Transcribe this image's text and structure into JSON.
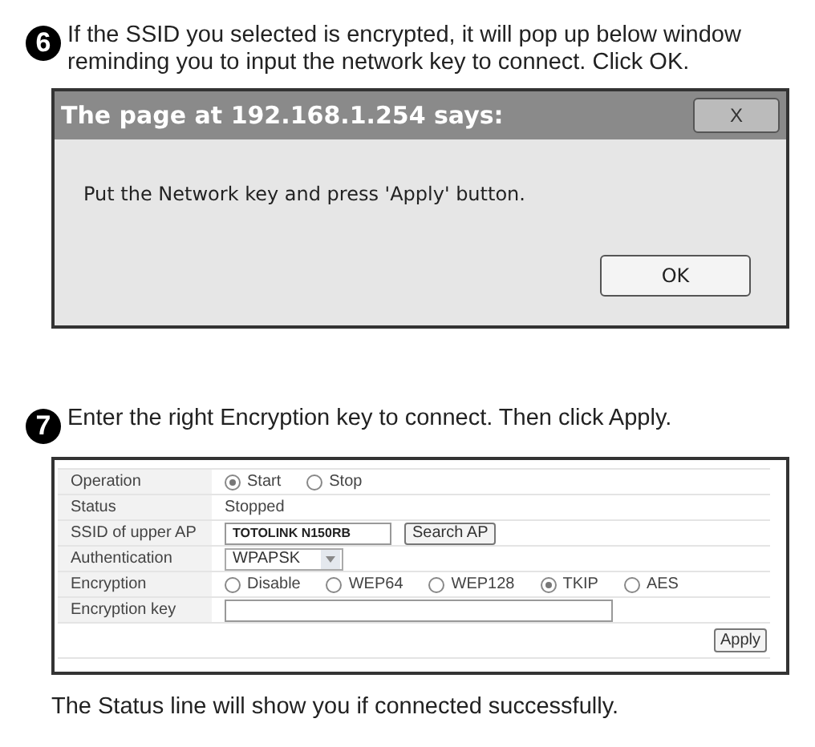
{
  "step_6": {
    "number": "6",
    "text": "If the SSID you selected is encrypted, it will pop up below window reminding you to input the network key to connect. Click OK."
  },
  "dialog": {
    "title": "The page at 192.168.1.254 says:",
    "close": "X",
    "message": "Put the Network key and press 'Apply' button.",
    "button": "OK"
  },
  "step_7": {
    "number": "7",
    "text": "Enter the right Encryption key to connect. Then click Apply."
  },
  "form": {
    "rows": [
      {
        "kind": "radio",
        "label": "Operation",
        "options": [
          {
            "label": "Start",
            "selected": true
          },
          {
            "label": "Stop",
            "selected": false
          }
        ]
      },
      {
        "kind": "text",
        "label": "Status",
        "value": "Stopped"
      },
      {
        "kind": "input",
        "label": "SSID of upper AP",
        "value": "TOTOLINK N150RB",
        "button": "Search AP"
      },
      {
        "kind": "select",
        "label": "Authentication",
        "value": "WPAPSK"
      },
      {
        "kind": "radio",
        "label": "Encryption",
        "options": [
          {
            "label": "Disable",
            "selected": false
          },
          {
            "label": "WEP64",
            "selected": false
          },
          {
            "label": "WEP128",
            "selected": false
          },
          {
            "label": "TKIP",
            "selected": true
          },
          {
            "label": "AES",
            "selected": false
          }
        ]
      },
      {
        "kind": "input",
        "label": "Encryption key",
        "value": ""
      }
    ],
    "button": "Apply"
  },
  "footer": "The Status line will show you if connected successfully."
}
